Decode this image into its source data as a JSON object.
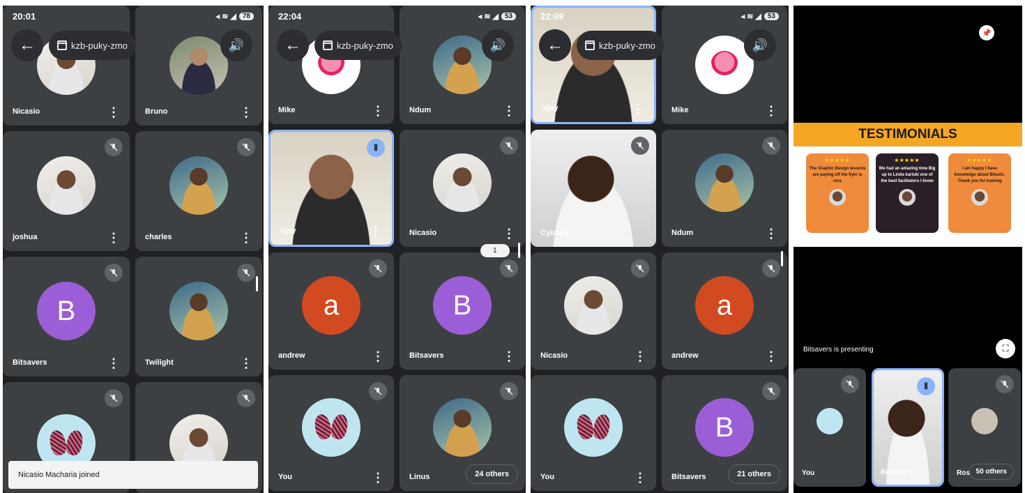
{
  "meeting_code": "kzb-puky-zmo",
  "panel1": {
    "time": "20:01",
    "battery": "78",
    "tiles": [
      {
        "name": "Nicasio"
      },
      {
        "name": "Bruno"
      },
      {
        "name": "joshua"
      },
      {
        "name": "charles"
      },
      {
        "name": "Bitsavers",
        "initial": "B"
      },
      {
        "name": "Twilight"
      },
      {
        "name": ""
      },
      {
        "name": ""
      }
    ],
    "toast": "Nicasio Macharia joined"
  },
  "panel2": {
    "time": "22:04",
    "battery": "53",
    "tiles": [
      {
        "name": "Mike"
      },
      {
        "name": "Ndum"
      },
      {
        "name": "Vjay"
      },
      {
        "name": "Nicasio"
      },
      {
        "name": "andrew",
        "initial": "a"
      },
      {
        "name": "Bitsavers",
        "initial": "B"
      },
      {
        "name": "You"
      },
      {
        "name": "Linus"
      }
    ],
    "others": "24 others",
    "page_badge": "1"
  },
  "panel3": {
    "time": "22:09",
    "battery": "53",
    "tiles": [
      {
        "name": "Vjay"
      },
      {
        "name": "Mike"
      },
      {
        "name": "Cyusen"
      },
      {
        "name": "Ndum"
      },
      {
        "name": "Nicasio"
      },
      {
        "name": "andrew",
        "initial": "a"
      },
      {
        "name": "You"
      },
      {
        "name": "Bitsavers",
        "initial": "B"
      }
    ],
    "others": "21 others"
  },
  "panel4": {
    "slide_title": "TESTIMONIALS",
    "stars": "★★★★★",
    "cards": [
      {
        "text": "The Graphic Design lessons are paying off the flyer is nice"
      },
      {
        "text": "We had an amazing time Big up to Linda kariuki one of the best facilitators I know"
      },
      {
        "text": "I am happy I have knowledge about Bitsolo. Thank you for training"
      }
    ],
    "presenting": "Bitsavers is presenting",
    "strip": [
      {
        "name": "You"
      },
      {
        "name": "Bitsavers"
      },
      {
        "name": "Rose"
      }
    ],
    "others": "50 others"
  },
  "colors": {
    "background": "#202124",
    "tile": "#3c4043",
    "active_border": "#8ab4f8",
    "avatar_purple": "#9c5ed6",
    "avatar_orange": "#d24a20",
    "slide_band": "#f5a623"
  }
}
